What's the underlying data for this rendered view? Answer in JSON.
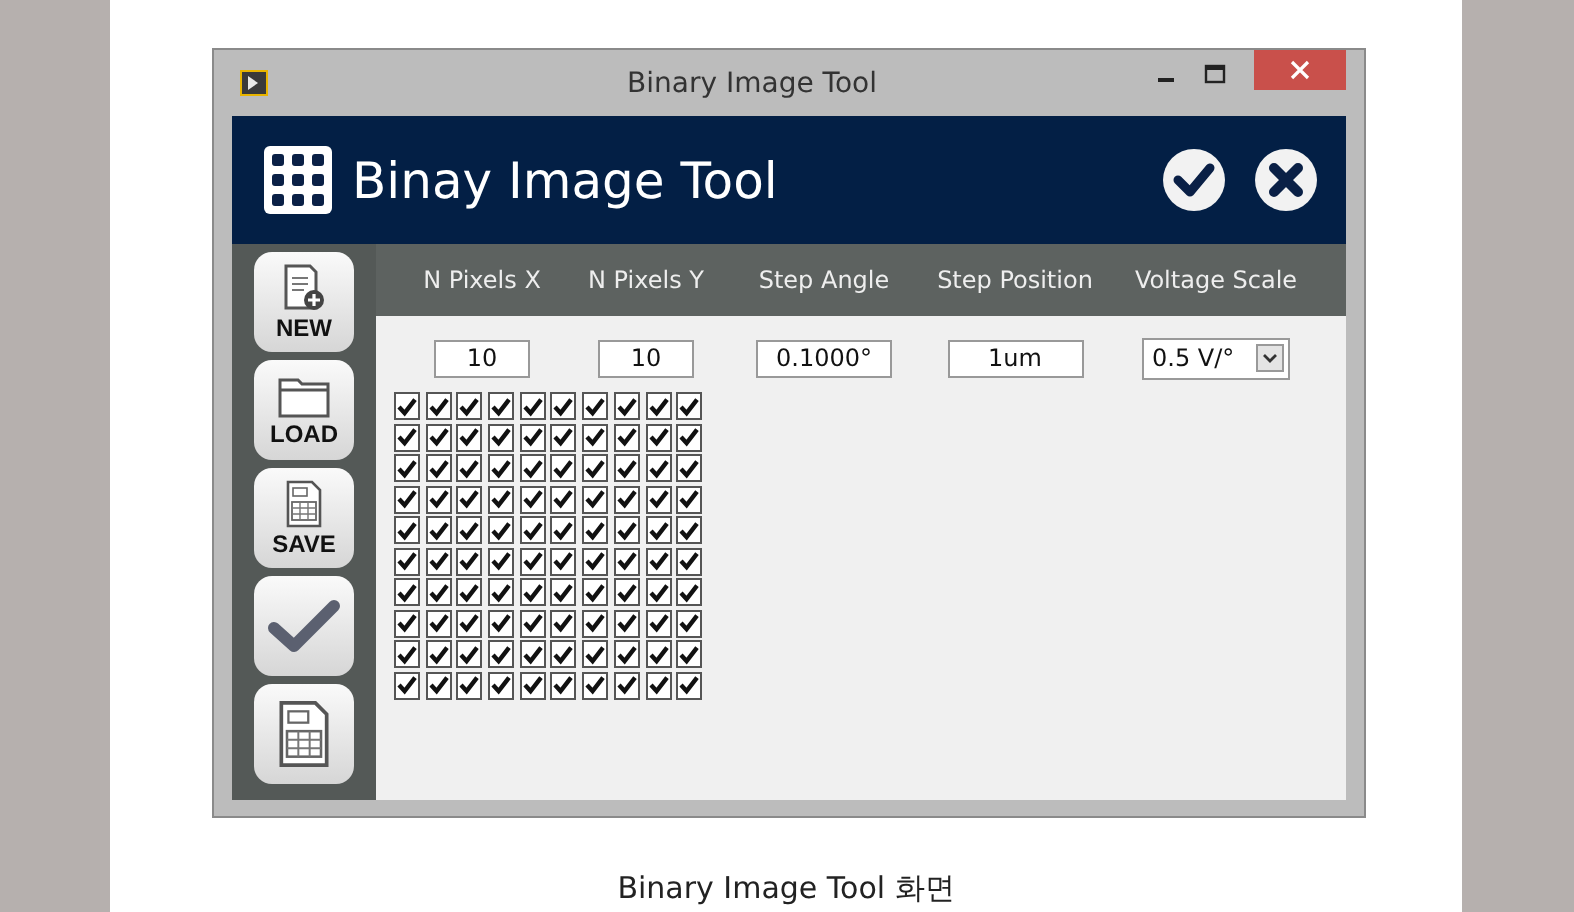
{
  "window": {
    "title": "Binary Image Tool"
  },
  "header": {
    "title": "Binay Image Tool"
  },
  "sidebar": {
    "buttons": [
      {
        "kind": "new",
        "label": "NEW"
      },
      {
        "kind": "load",
        "label": "LOAD"
      },
      {
        "kind": "save",
        "label": "SAVE"
      },
      {
        "kind": "check"
      },
      {
        "kind": "card"
      }
    ]
  },
  "settings": [
    {
      "label": "N Pixels X",
      "value": "10",
      "kind": "field"
    },
    {
      "label": "N Pixels Y",
      "value": "10",
      "kind": "field"
    },
    {
      "label": "Step Angle",
      "value": "0.1000°",
      "kind": "field"
    },
    {
      "label": "Step Position",
      "value": "1um",
      "kind": "field"
    },
    {
      "label": "Voltage Scale",
      "value": "0.5 V/°",
      "kind": "dropdown"
    }
  ],
  "grid": [
    [
      true,
      true,
      true,
      true,
      true,
      true,
      true,
      true,
      true,
      true
    ],
    [
      true,
      true,
      true,
      true,
      true,
      true,
      true,
      true,
      true,
      true
    ],
    [
      true,
      true,
      true,
      true,
      true,
      true,
      true,
      true,
      true,
      true
    ],
    [
      true,
      true,
      true,
      true,
      true,
      true,
      true,
      true,
      true,
      true
    ],
    [
      true,
      true,
      true,
      true,
      true,
      true,
      true,
      true,
      true,
      true
    ],
    [
      true,
      true,
      true,
      true,
      true,
      true,
      true,
      true,
      true,
      true
    ],
    [
      true,
      true,
      true,
      true,
      true,
      true,
      true,
      true,
      true,
      true
    ],
    [
      true,
      true,
      true,
      true,
      true,
      true,
      true,
      true,
      true,
      true
    ],
    [
      true,
      true,
      true,
      true,
      true,
      true,
      true,
      true,
      true,
      true
    ],
    [
      true,
      true,
      true,
      true,
      true,
      true,
      true,
      true,
      true,
      true
    ]
  ],
  "caption": "Binary Image Tool 화면"
}
